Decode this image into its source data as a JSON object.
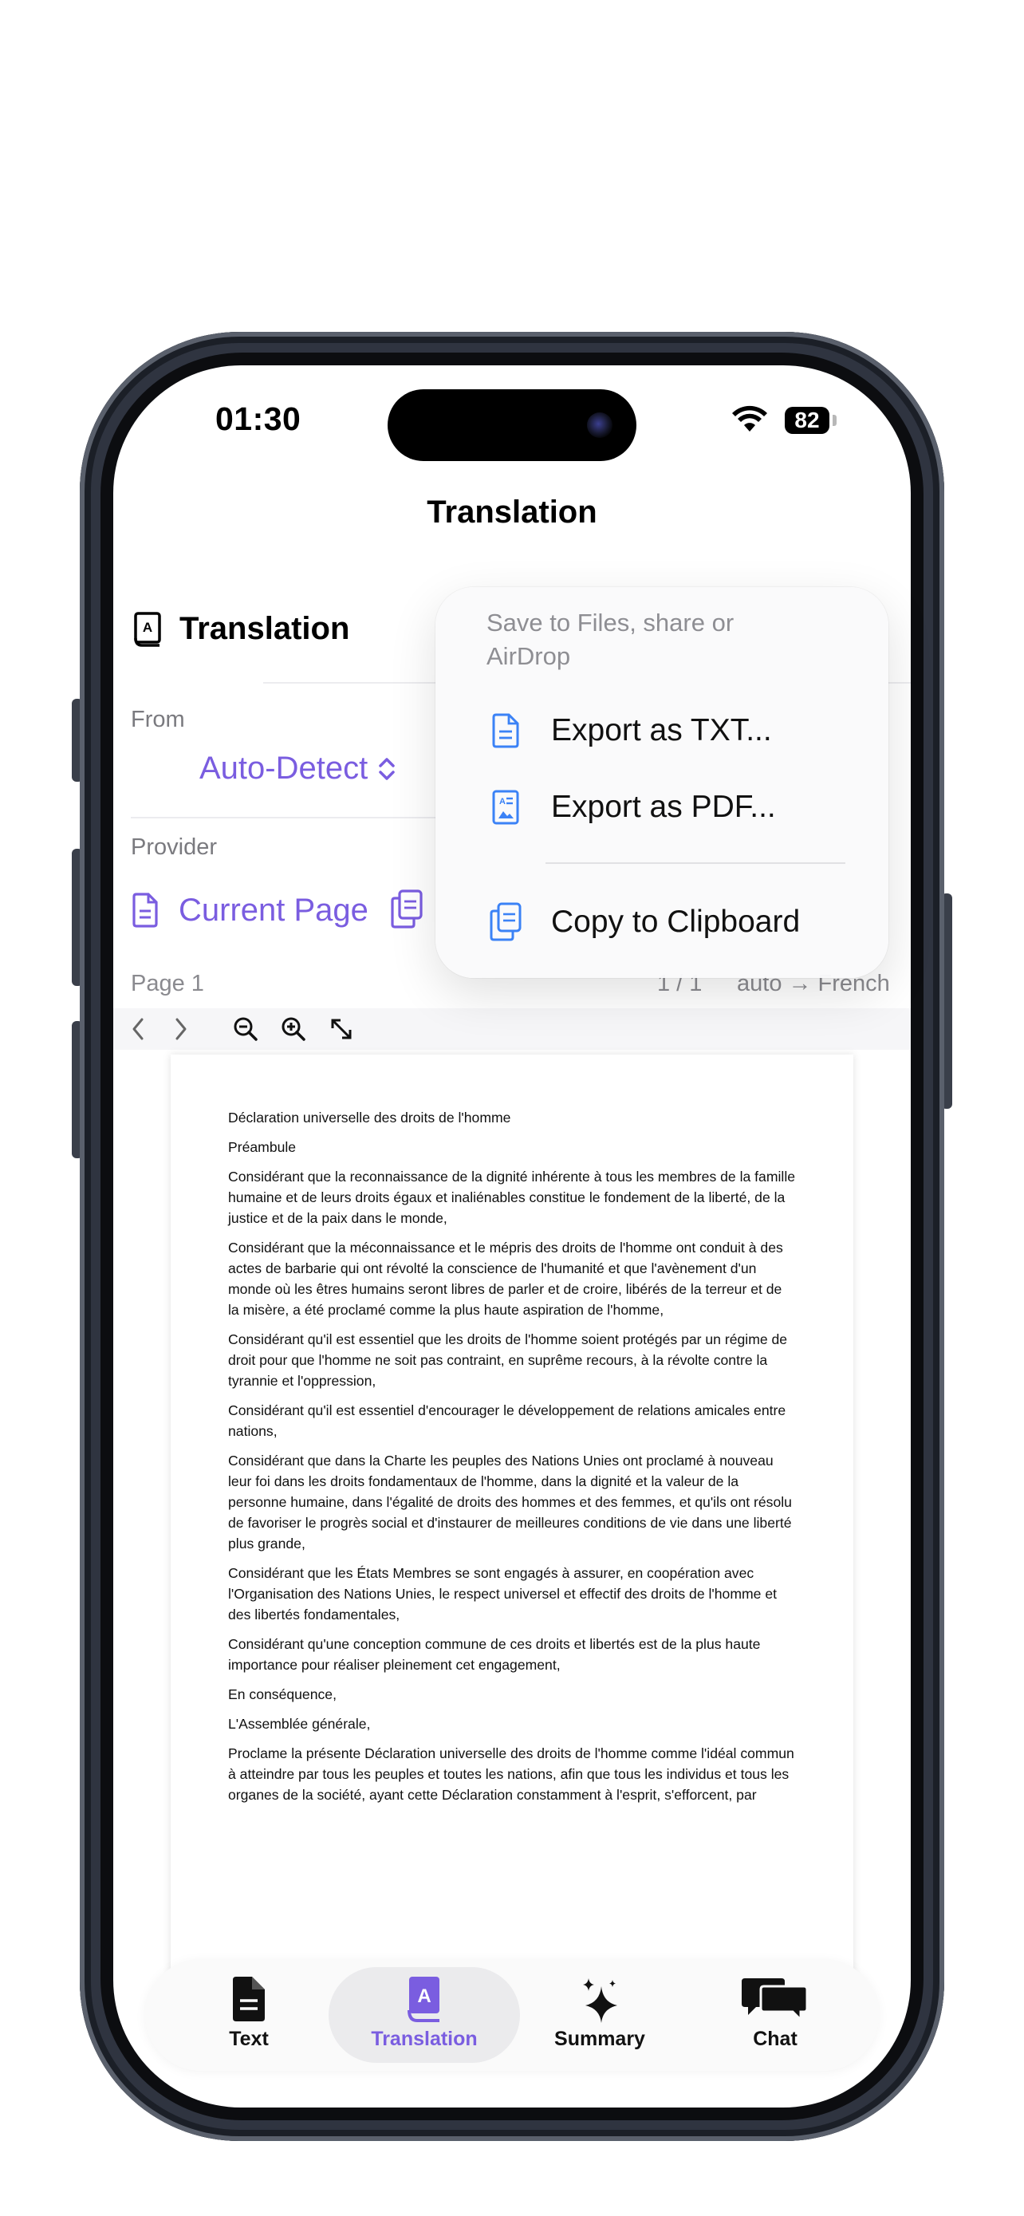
{
  "status_bar": {
    "time": "01:30",
    "battery": "82"
  },
  "nav": {
    "title": "Translation"
  },
  "section": {
    "title": "Translation"
  },
  "from": {
    "label": "From",
    "value": "Auto-Detect"
  },
  "provider": {
    "label": "Provider",
    "value": "Current Page"
  },
  "page_bar": {
    "page": "Page 1",
    "count": "1 / 1",
    "direction": "auto → French"
  },
  "export_menu": {
    "header": "Save to Files, share or AirDrop",
    "items": [
      {
        "label": "Export as TXT..."
      },
      {
        "label": "Export as PDF..."
      },
      {
        "label": "Copy to Clipboard"
      }
    ]
  },
  "document": {
    "paragraphs": [
      "Déclaration universelle des droits de l'homme",
      "Préambule",
      "Considérant que la reconnaissance de la dignité inhérente à tous les membres de la famille humaine et de leurs droits égaux et inaliénables constitue le fondement de la liberté, de la justice et de la paix dans le monde,",
      "Considérant que la méconnaissance et le mépris des droits de l'homme ont conduit à des actes de barbarie qui ont révolté la conscience de l'humanité et que l'avènement d'un monde où les êtres humains seront libres de parler et de croire, libérés de la terreur et de la misère, a été proclamé comme la plus haute aspiration de l'homme,",
      "Considérant qu'il est essentiel que les droits de l'homme soient protégés par un régime de droit pour que l'homme ne soit pas contraint, en suprême recours, à la révolte contre la tyrannie et l'oppression,",
      "Considérant qu'il est essentiel d'encourager le développement de relations amicales entre nations,",
      "Considérant que dans la Charte les peuples des Nations Unies ont proclamé à nouveau leur foi dans les droits fondamentaux de l'homme, dans la dignité et la valeur de la personne humaine, dans l'égalité de droits des hommes et des femmes, et qu'ils ont résolu de favoriser le progrès social et d'instaurer de meilleures conditions de vie dans une liberté plus grande,",
      "Considérant que les États Membres se sont engagés à assurer, en coopération avec l'Organisation des Nations Unies, le respect universel et effectif des droits de l'homme et des libertés fondamentales,",
      "Considérant qu'une conception commune de ces droits et libertés est de la plus haute importance pour réaliser pleinement cet engagement,",
      "En conséquence,",
      "L'Assemblée générale,",
      "Proclame la présente Déclaration universelle des droits de l'homme comme l'idéal commun à atteindre par tous les peuples et toutes les nations, afin que tous les individus et tous les organes de la société, ayant cette Déclaration constamment à l'esprit, s'efforcent, par"
    ]
  },
  "tabs": [
    {
      "label": "Text",
      "icon": "document-icon"
    },
    {
      "label": "Translation",
      "icon": "book-icon"
    },
    {
      "label": "Summary",
      "icon": "sparkles-icon"
    },
    {
      "label": "Chat",
      "icon": "chat-bubbles-icon"
    }
  ],
  "colors": {
    "accent": "#7a5de0",
    "menu_icon": "#3b82f6"
  }
}
